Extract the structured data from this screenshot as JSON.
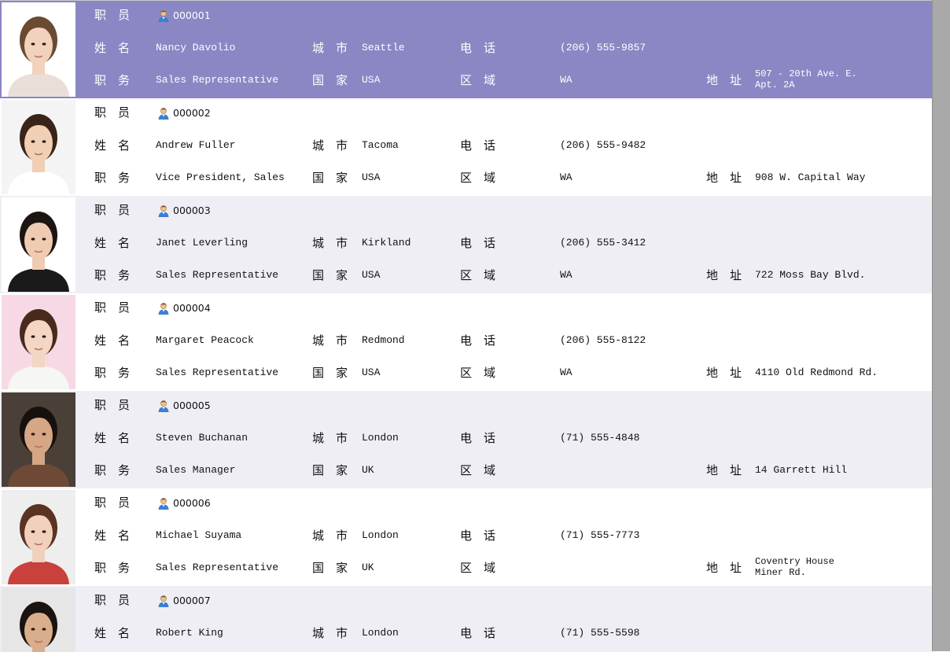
{
  "labels": {
    "employee": "职　员",
    "name": "姓　名",
    "title": "职　务",
    "city": "城　市",
    "country": "国　家",
    "phone": "电　话",
    "region": "区　域",
    "address": "地　址"
  },
  "employees": [
    {
      "id": "000001",
      "name": "Nancy Davolio",
      "title": "Sales Representative",
      "city": "Seattle",
      "country": "USA",
      "phone": "(206) 555-9857",
      "region": "WA",
      "address": "507 - 20th Ave. E.",
      "address2": "Apt. 2A",
      "hair": "#6b4a32",
      "skin": "#f1d2bd",
      "bg": "#ffffff",
      "shirt": "#e9dfd8"
    },
    {
      "id": "000002",
      "name": "Andrew Fuller",
      "title": "Vice President, Sales",
      "city": "Tacoma",
      "country": "USA",
      "phone": "(206) 555-9482",
      "region": "WA",
      "address": "908 W. Capital Way",
      "address2": "",
      "hair": "#3a2418",
      "skin": "#f0cfb4",
      "bg": "#f4f4f4",
      "shirt": "#ffffff"
    },
    {
      "id": "000003",
      "name": "Janet Leverling",
      "title": "Sales Representative",
      "city": "Kirkland",
      "country": "USA",
      "phone": "(206) 555-3412",
      "region": "WA",
      "address": "722 Moss Bay Blvd.",
      "address2": "",
      "hair": "#1c1511",
      "skin": "#efcbb2",
      "bg": "#ffffff",
      "shirt": "#1a1a1a"
    },
    {
      "id": "000004",
      "name": "Margaret Peacock",
      "title": "Sales Representative",
      "city": "Redmond",
      "country": "USA",
      "phone": "(206) 555-8122",
      "region": "WA",
      "address": "4110 Old Redmond Rd.",
      "address2": "",
      "hair": "#4a2a1c",
      "skin": "#f3d6c4",
      "bg": "#f7d9e6",
      "shirt": "#f6f6f2"
    },
    {
      "id": "000005",
      "name": "Steven Buchanan",
      "title": "Sales Manager",
      "city": "London",
      "country": "UK",
      "phone": "(71) 555-4848",
      "region": "",
      "address": "14 Garrett Hill",
      "address2": "",
      "hair": "#17110e",
      "skin": "#d6a784",
      "bg": "#4a4038",
      "shirt": "#6e4a36"
    },
    {
      "id": "000006",
      "name": "Michael Suyama",
      "title": "Sales Representative",
      "city": "London",
      "country": "UK",
      "phone": "(71) 555-7773",
      "region": "",
      "address": "Coventry House",
      "address2": "Miner Rd.",
      "hair": "#5a3322",
      "skin": "#f1d0bc",
      "bg": "#eeeeee",
      "shirt": "#c8413c"
    },
    {
      "id": "000007",
      "name": "Robert King",
      "title": "",
      "city": "London",
      "country": "",
      "phone": "(71) 555-5598",
      "region": "",
      "address": "",
      "address2": "",
      "hair": "#1a1310",
      "skin": "#d9ae8c",
      "bg": "#e6e6e6",
      "shirt": "#2a4fa8"
    }
  ]
}
